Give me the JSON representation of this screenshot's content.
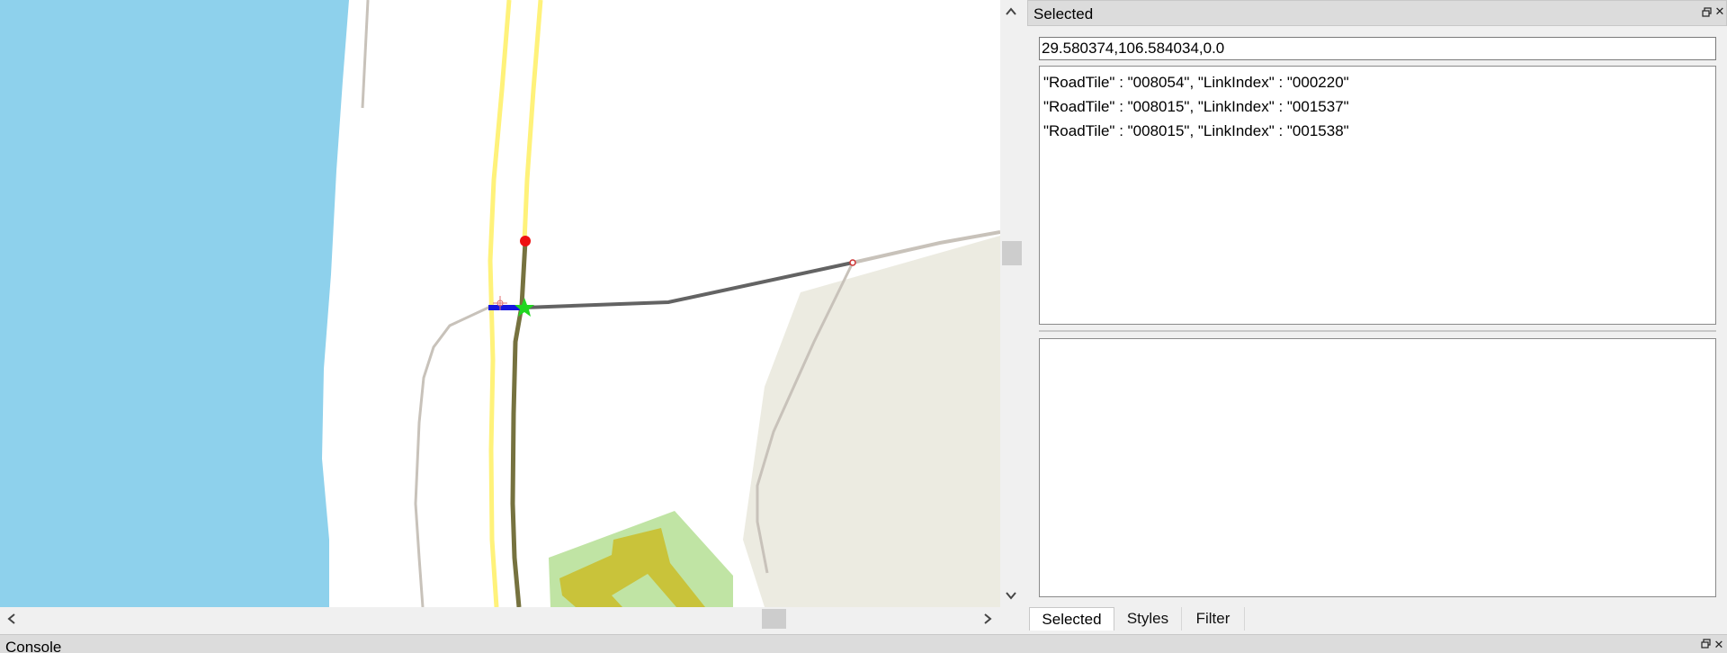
{
  "map": {
    "colors": {
      "water": "#8ed1ec",
      "highway": "#fff27a",
      "arterial": "#76723f",
      "selected_road": "#636363",
      "minor_road": "#c8c2ba",
      "landuse": "#ecebe1",
      "park": "#c0e4a4",
      "park_inner": "#c9c33a",
      "selection": "#1616e0",
      "node": "#ee1111",
      "snap_marker": "#21d621"
    }
  },
  "scrollbars": {
    "up_icon": "chevron-up-icon",
    "down_icon": "chevron-down-icon",
    "left_icon": "chevron-left-icon",
    "right_icon": "chevron-right-icon"
  },
  "selected_panel": {
    "title": "Selected",
    "coordinate": "29.580374,106.584034,0.0",
    "items": [
      "\"RoadTile\" : \"008054\", \"LinkIndex\" : \"000220\"",
      "\"RoadTile\" : \"008015\", \"LinkIndex\" : \"001537\"",
      "\"RoadTile\" : \"008015\", \"LinkIndex\" : \"001538\""
    ],
    "tabs": [
      "Selected",
      "Styles",
      "Filter"
    ]
  },
  "console": {
    "title": "Console"
  }
}
